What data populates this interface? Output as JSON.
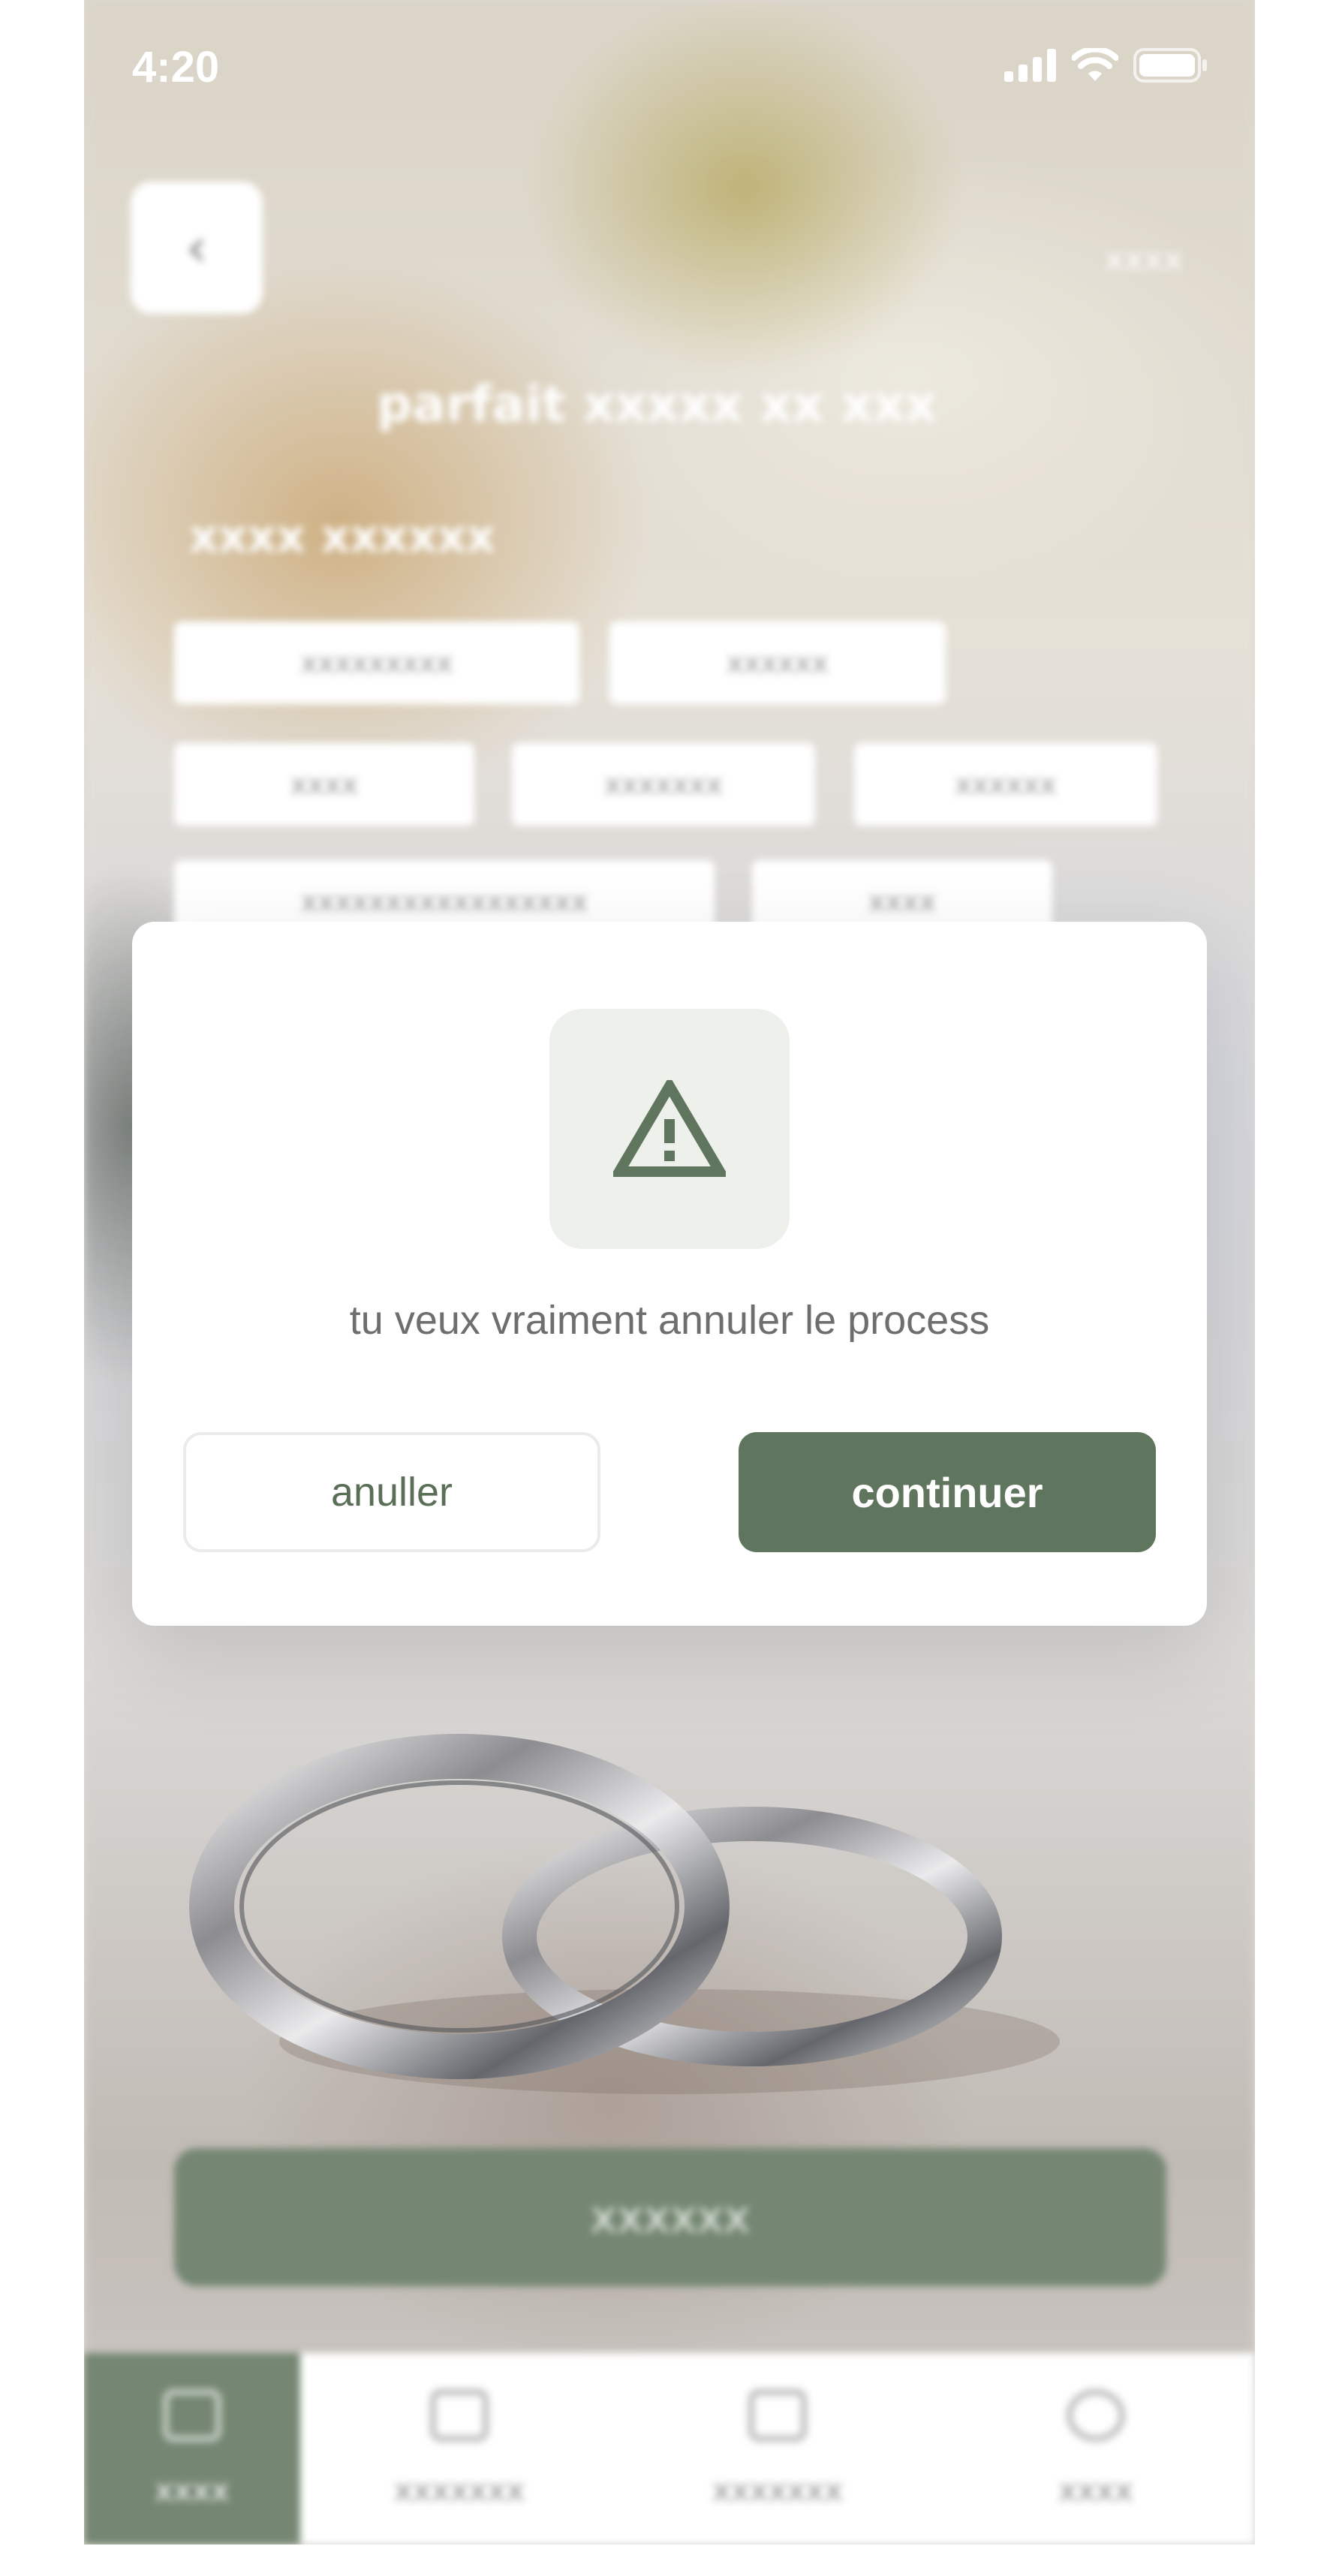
{
  "status_bar": {
    "time": "4:20"
  },
  "background_screen": {
    "back_icon": "chevron-left-icon",
    "top_right": "xxxx",
    "title": "parfait xxxxx xx xxx",
    "subtitle": "xxxx xxxxxx",
    "chips": [
      "xxxxxxxxx",
      "xxxxxx",
      "xxxx",
      "xxxxxxx",
      "xxxxxx",
      "xxxxxxxxxxxxxxxxx",
      "xxxx"
    ],
    "cta_label": "xxxxxx",
    "tabs": [
      {
        "label": "xxxx",
        "icon": "home-icon",
        "active": true
      },
      {
        "label": "xxxxxxx",
        "icon": "calendar-icon",
        "active": false
      },
      {
        "label": "xxxxxxx",
        "icon": "list-icon",
        "active": false
      },
      {
        "label": "xxxx",
        "icon": "user-icon",
        "active": false
      }
    ]
  },
  "modal": {
    "icon": "warning-icon",
    "message": "tu veux vraiment annuler le process",
    "cancel_label": "anuller",
    "continue_label": "continuer"
  },
  "colors": {
    "accent": "#5f755d",
    "icon_box_bg": "#eef0ec",
    "message_text": "#6e6e6e"
  }
}
